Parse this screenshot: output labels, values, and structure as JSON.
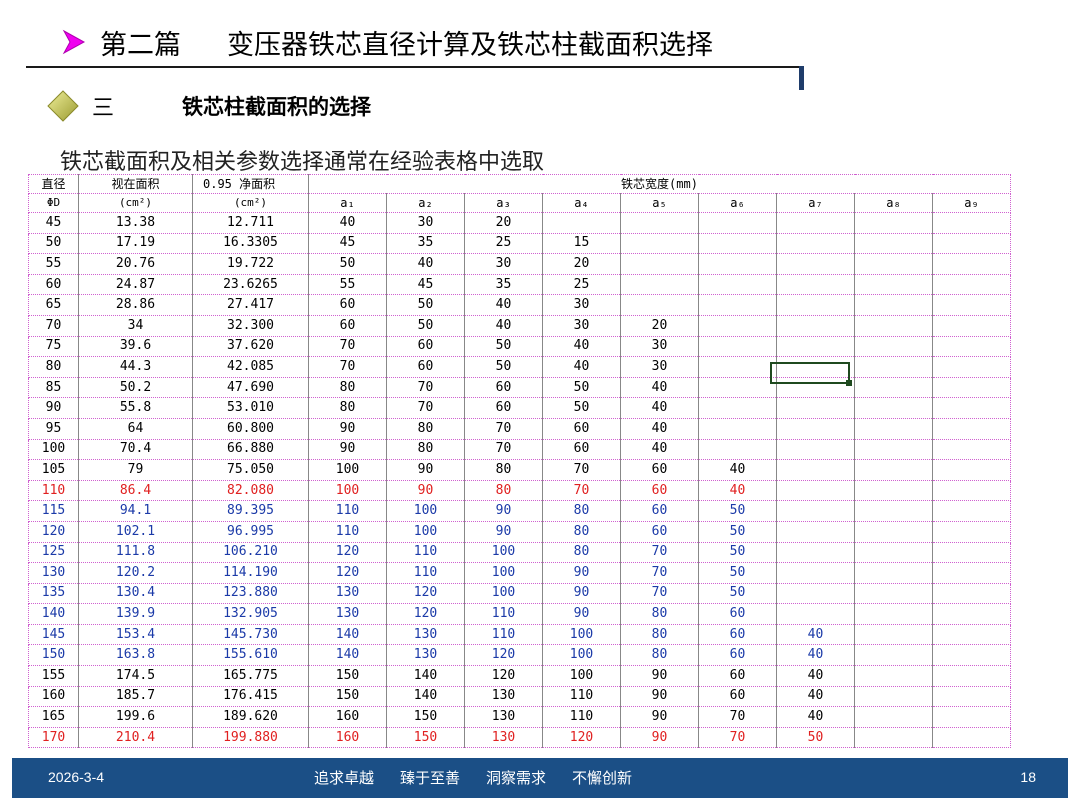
{
  "title": {
    "part": "第二篇",
    "subject": "变压器铁芯直径计算及铁芯柱截面积选择"
  },
  "section": {
    "number": "三",
    "title": "铁芯柱截面积的选择"
  },
  "intro": "铁芯截面积及相关参数选择通常在经验表格中选取",
  "colors": {
    "arrow": "#f000f0",
    "diamond": "#c9c95a",
    "footer": "#1b4f86",
    "highlight_red": "#e02020",
    "highlight_blue": "#1b3aa8",
    "grid": "#d060d0"
  },
  "table": {
    "header": {
      "diameter": "直径",
      "diameter_sym": "ΦD",
      "apparent_area": "视在面积",
      "apparent_area_unit": "(cm²)",
      "net_area": "0.95 净面积",
      "net_area_unit": "(cm²)",
      "width_group": "铁芯宽度(mm)",
      "widths": [
        "a₁",
        "a₂",
        "a₃",
        "a₄",
        "a₅",
        "a₆",
        "a₇",
        "a₈",
        "a₉"
      ]
    },
    "rows": [
      {
        "d": "45",
        "area": "13.38",
        "net": "12.711",
        "a": [
          "40",
          "30",
          "20",
          "",
          "",
          "",
          "",
          "",
          ""
        ],
        "style": ""
      },
      {
        "d": "50",
        "area": "17.19",
        "net": "16.3305",
        "a": [
          "45",
          "35",
          "25",
          "15",
          "",
          "",
          "",
          "",
          ""
        ],
        "style": ""
      },
      {
        "d": "55",
        "area": "20.76",
        "net": "19.722",
        "a": [
          "50",
          "40",
          "30",
          "20",
          "",
          "",
          "",
          "",
          ""
        ],
        "style": ""
      },
      {
        "d": "60",
        "area": "24.87",
        "net": "23.6265",
        "a": [
          "55",
          "45",
          "35",
          "25",
          "",
          "",
          "",
          "",
          ""
        ],
        "style": ""
      },
      {
        "d": "65",
        "area": "28.86",
        "net": "27.417",
        "a": [
          "60",
          "50",
          "40",
          "30",
          "",
          "",
          "",
          "",
          ""
        ],
        "style": ""
      },
      {
        "d": "70",
        "area": "34",
        "net": "32.300",
        "a": [
          "60",
          "50",
          "40",
          "30",
          "20",
          "",
          "",
          "",
          ""
        ],
        "style": ""
      },
      {
        "d": "75",
        "area": "39.6",
        "net": "37.620",
        "a": [
          "70",
          "60",
          "50",
          "40",
          "30",
          "",
          "",
          "",
          ""
        ],
        "style": ""
      },
      {
        "d": "80",
        "area": "44.3",
        "net": "42.085",
        "a": [
          "70",
          "60",
          "50",
          "40",
          "30",
          "",
          "",
          "",
          ""
        ],
        "style": ""
      },
      {
        "d": "85",
        "area": "50.2",
        "net": "47.690",
        "a": [
          "80",
          "70",
          "60",
          "50",
          "40",
          "",
          "",
          "",
          ""
        ],
        "style": ""
      },
      {
        "d": "90",
        "area": "55.8",
        "net": "53.010",
        "a": [
          "80",
          "70",
          "60",
          "50",
          "40",
          "",
          "",
          "",
          ""
        ],
        "style": ""
      },
      {
        "d": "95",
        "area": "64",
        "net": "60.800",
        "a": [
          "90",
          "80",
          "70",
          "60",
          "40",
          "",
          "",
          "",
          ""
        ],
        "style": ""
      },
      {
        "d": "100",
        "area": "70.4",
        "net": "66.880",
        "a": [
          "90",
          "80",
          "70",
          "60",
          "40",
          "",
          "",
          "",
          ""
        ],
        "style": ""
      },
      {
        "d": "105",
        "area": "79",
        "net": "75.050",
        "a": [
          "100",
          "90",
          "80",
          "70",
          "60",
          "40",
          "",
          "",
          ""
        ],
        "style": ""
      },
      {
        "d": "110",
        "area": "86.4",
        "net": "82.080",
        "a": [
          "100",
          "90",
          "80",
          "70",
          "60",
          "40",
          "",
          "",
          ""
        ],
        "style": "red"
      },
      {
        "d": "115",
        "area": "94.1",
        "net": "89.395",
        "a": [
          "110",
          "100",
          "90",
          "80",
          "60",
          "50",
          "",
          "",
          ""
        ],
        "style": "blue"
      },
      {
        "d": "120",
        "area": "102.1",
        "net": "96.995",
        "a": [
          "110",
          "100",
          "90",
          "80",
          "60",
          "50",
          "",
          "",
          ""
        ],
        "style": "blue"
      },
      {
        "d": "125",
        "area": "111.8",
        "net": "106.210",
        "a": [
          "120",
          "110",
          "100",
          "80",
          "70",
          "50",
          "",
          "",
          ""
        ],
        "style": "blue"
      },
      {
        "d": "130",
        "area": "120.2",
        "net": "114.190",
        "a": [
          "120",
          "110",
          "100",
          "90",
          "70",
          "50",
          "",
          "",
          ""
        ],
        "style": "blue"
      },
      {
        "d": "135",
        "area": "130.4",
        "net": "123.880",
        "a": [
          "130",
          "120",
          "100",
          "90",
          "70",
          "50",
          "",
          "",
          ""
        ],
        "style": "blue"
      },
      {
        "d": "140",
        "area": "139.9",
        "net": "132.905",
        "a": [
          "130",
          "120",
          "110",
          "90",
          "80",
          "60",
          "",
          "",
          ""
        ],
        "style": "blue"
      },
      {
        "d": "145",
        "area": "153.4",
        "net": "145.730",
        "a": [
          "140",
          "130",
          "110",
          "100",
          "80",
          "60",
          "40",
          "",
          ""
        ],
        "style": "blue"
      },
      {
        "d": "150",
        "area": "163.8",
        "net": "155.610",
        "a": [
          "140",
          "130",
          "120",
          "100",
          "80",
          "60",
          "40",
          "",
          ""
        ],
        "style": "blue"
      },
      {
        "d": "155",
        "area": "174.5",
        "net": "165.775",
        "a": [
          "150",
          "140",
          "120",
          "100",
          "90",
          "60",
          "40",
          "",
          ""
        ],
        "style": ""
      },
      {
        "d": "160",
        "area": "185.7",
        "net": "176.415",
        "a": [
          "150",
          "140",
          "130",
          "110",
          "90",
          "60",
          "40",
          "",
          ""
        ],
        "style": ""
      },
      {
        "d": "165",
        "area": "199.6",
        "net": "189.620",
        "a": [
          "160",
          "150",
          "130",
          "110",
          "90",
          "70",
          "40",
          "",
          ""
        ],
        "style": ""
      },
      {
        "d": "170",
        "area": "210.4",
        "net": "199.880",
        "a": [
          "160",
          "150",
          "130",
          "120",
          "90",
          "70",
          "50",
          "",
          ""
        ],
        "style": "red"
      }
    ]
  },
  "footer": {
    "date": "2026-3-4",
    "mottos": [
      "追求卓越",
      "臻于至善",
      "洞察需求",
      "不懈创新"
    ],
    "page": "18"
  }
}
